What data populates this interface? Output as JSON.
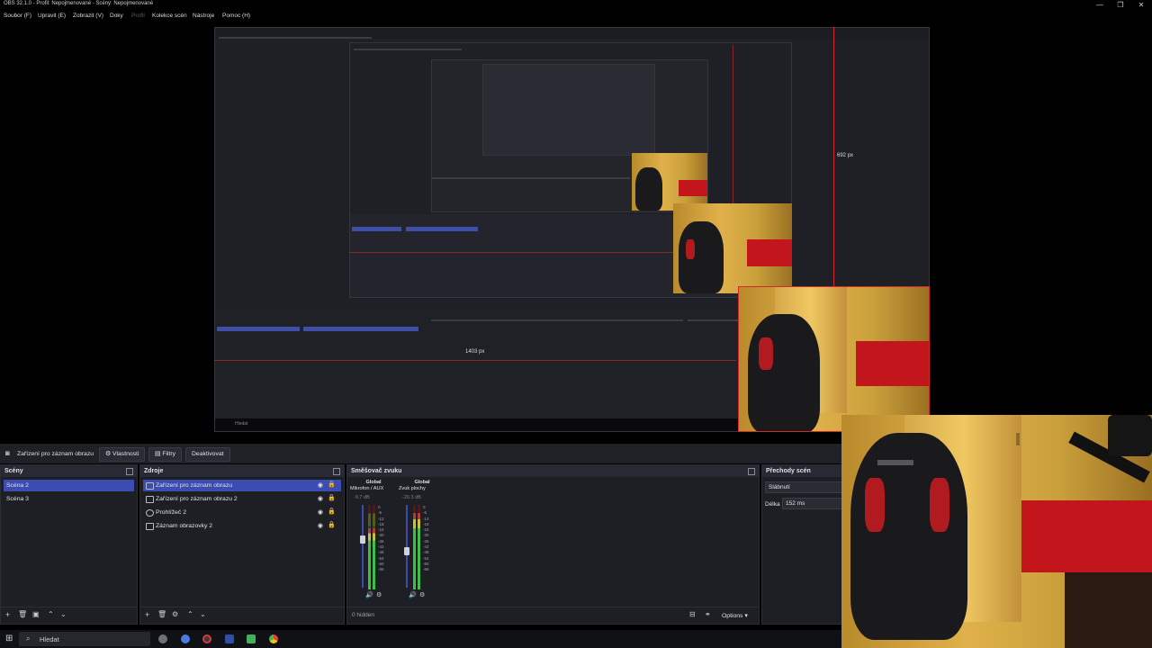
{
  "window": {
    "title": "OBS 32.1.0 - Profil: Nepojmenované - Scény: Nepojmenované",
    "controls": [
      "—",
      "❐",
      "✕"
    ]
  },
  "menu": {
    "items": [
      "Soubor (F)",
      "Upravit (E)",
      "Zobrazit (V)",
      "Doky",
      "Profil",
      "Kolekce scén",
      "Nástroje",
      "Pomoc (H)"
    ]
  },
  "preview": {
    "measure_vertical": "692 px",
    "measure_horizontal": "1403 px",
    "nested_inner_label": "Hledat"
  },
  "source_toolbar": {
    "selected_source": "Zařízení pro záznam obrazu",
    "properties_label": "Vlastnosti",
    "filters_label": "Filtry",
    "deactivate_label": "Deaktivovat"
  },
  "scenes": {
    "title": "Scény",
    "items": [
      {
        "label": "Scéna 2",
        "selected": true
      },
      {
        "label": "Scéna 3",
        "selected": false
      }
    ]
  },
  "sources": {
    "title": "Zdroje",
    "items": [
      {
        "label": "Zařízení pro záznam obrazu",
        "selected": true
      },
      {
        "label": "Zařízení pro záznam obrazu 2",
        "selected": false
      },
      {
        "label": "Prohlížeč 2",
        "selected": false
      },
      {
        "label": "Záznam obrazovky 2",
        "selected": false
      }
    ]
  },
  "mixer": {
    "title": "Směšovač zvuku",
    "channels": [
      {
        "tag": "Global",
        "name": "Mikrofon / AUX",
        "db": "-9.7 dB",
        "level": 0.72,
        "fader": 0.6
      },
      {
        "tag": "Global",
        "name": "Zvuk plochy",
        "db": "-20.3 dB",
        "level": 0.9,
        "fader": 0.45
      }
    ],
    "scale": [
      "0",
      "-6",
      "-12",
      "-18",
      "-24",
      "-30",
      "-36",
      "-42",
      "-48",
      "-54",
      "-60",
      "-66"
    ],
    "hidden_label": "0 hidden",
    "options_label": "Options"
  },
  "transitions": {
    "title": "Přechody scén",
    "type_value": "Slábnutí",
    "duration_label": "Délka",
    "duration_value": "152 ms"
  },
  "taskbar": {
    "search_placeholder": "Hledat"
  },
  "colors": {
    "accent": "#3d4cb0",
    "measure_red": "#d12a2a",
    "dock_bg": "#1e1f25"
  }
}
